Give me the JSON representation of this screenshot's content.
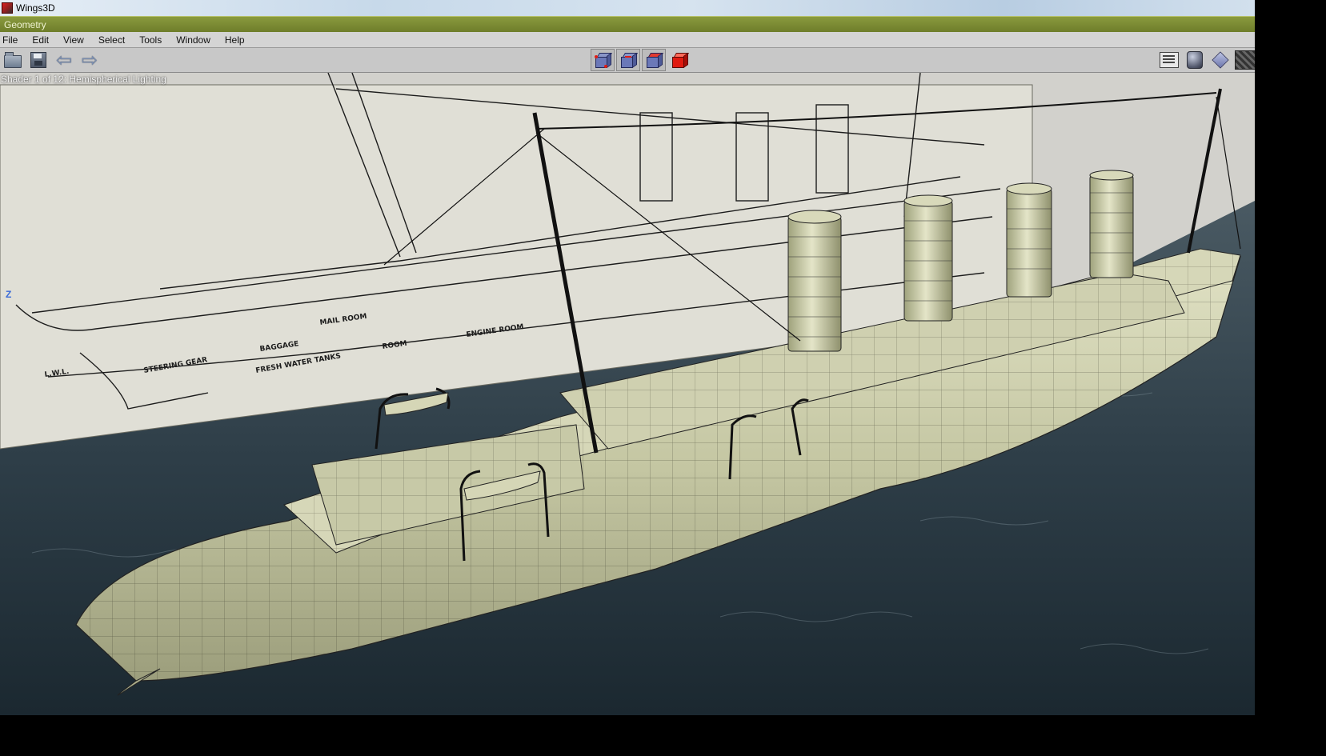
{
  "window": {
    "title": "Wings3D",
    "mode_bar": "Geometry"
  },
  "menu": [
    "File",
    "Edit",
    "View",
    "Select",
    "Tools",
    "Window",
    "Help"
  ],
  "toolbar": {
    "left_icons": [
      "open-folder-icon",
      "save-disk-icon",
      "undo-arrow-icon",
      "redo-arrow-icon"
    ],
    "selection_modes": [
      "vertex-select-icon",
      "edge-select-icon",
      "face-select-icon",
      "body-select-icon"
    ],
    "right_icons": [
      "outliner-icon",
      "smooth-shading-icon",
      "wireframe-icon",
      "texture-icon"
    ]
  },
  "viewport": {
    "shader_info": "Shader 1 of 12: Hemispherical Lighting",
    "axis_label": "Z",
    "blueprint_labels": [
      "MAIL ROOM",
      "BAGGAGE",
      "ROOM",
      "ENGINE ROOM",
      "STEERING GEAR",
      "FRESH WATER TANKS",
      "L.W.L."
    ]
  },
  "colors": {
    "accent_bar": "#7b8a30",
    "hull": "#c8c9a8",
    "water": "#2d3d47"
  }
}
